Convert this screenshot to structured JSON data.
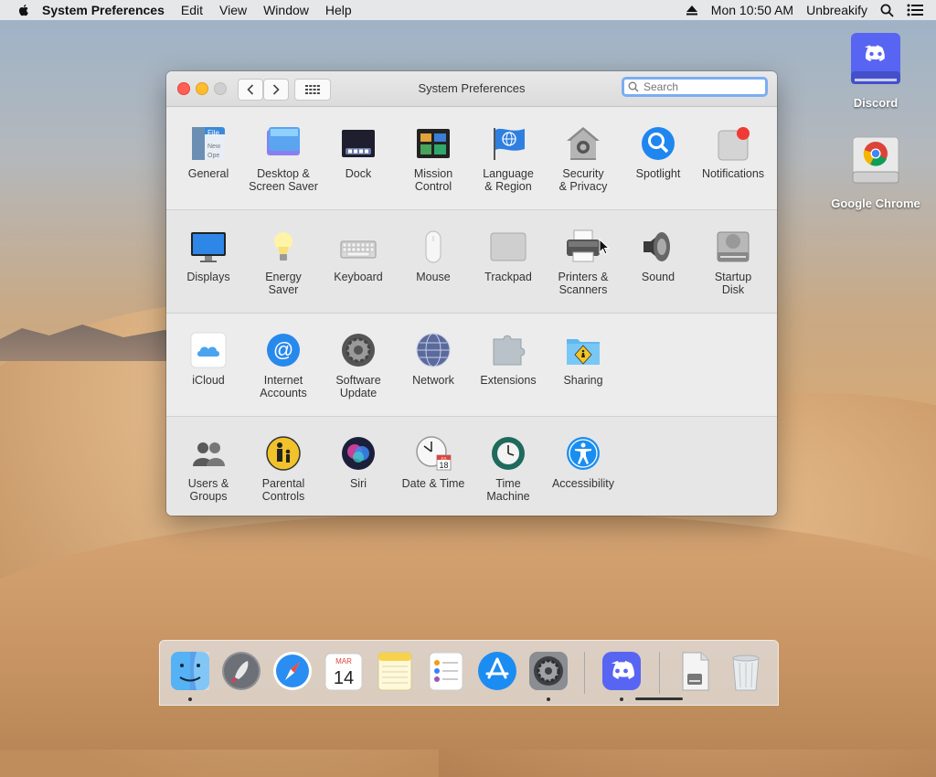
{
  "menubar": {
    "app_name": "System Preferences",
    "menus": [
      "Edit",
      "View",
      "Window",
      "Help"
    ],
    "clock": "Mon 10:50 AM",
    "extra_app": "Unbreakify"
  },
  "window": {
    "title": "System Preferences",
    "search_placeholder": "Search"
  },
  "panes": {
    "row1": [
      "General",
      "Desktop &\nScreen Saver",
      "Dock",
      "Mission\nControl",
      "Language\n& Region",
      "Security\n& Privacy",
      "Spotlight",
      "Notifications"
    ],
    "row2": [
      "Displays",
      "Energy\nSaver",
      "Keyboard",
      "Mouse",
      "Trackpad",
      "Printers &\nScanners",
      "Sound",
      "Startup\nDisk"
    ],
    "row3": [
      "iCloud",
      "Internet\nAccounts",
      "Software\nUpdate",
      "Network",
      "Extensions",
      "Sharing"
    ],
    "row4": [
      "Users &\nGroups",
      "Parental\nControls",
      "Siri",
      "Date & Time",
      "Time\nMachine",
      "Accessibility"
    ]
  },
  "desktop": {
    "icons": [
      "Discord",
      "Google Chrome"
    ]
  },
  "dock": {
    "items": [
      "Finder",
      "Launchpad",
      "Safari",
      "Calendar",
      "Notes",
      "Reminders",
      "App Store",
      "System Preferences",
      "Discord",
      "Downloads",
      "Trash"
    ],
    "calendar_month": "MAR",
    "calendar_day": "14"
  },
  "icons": {
    "general_file_label": "File",
    "general_new_label": "New",
    "general_open_label": "Ope",
    "date_time_month": "JUL",
    "date_time_day": "18"
  }
}
